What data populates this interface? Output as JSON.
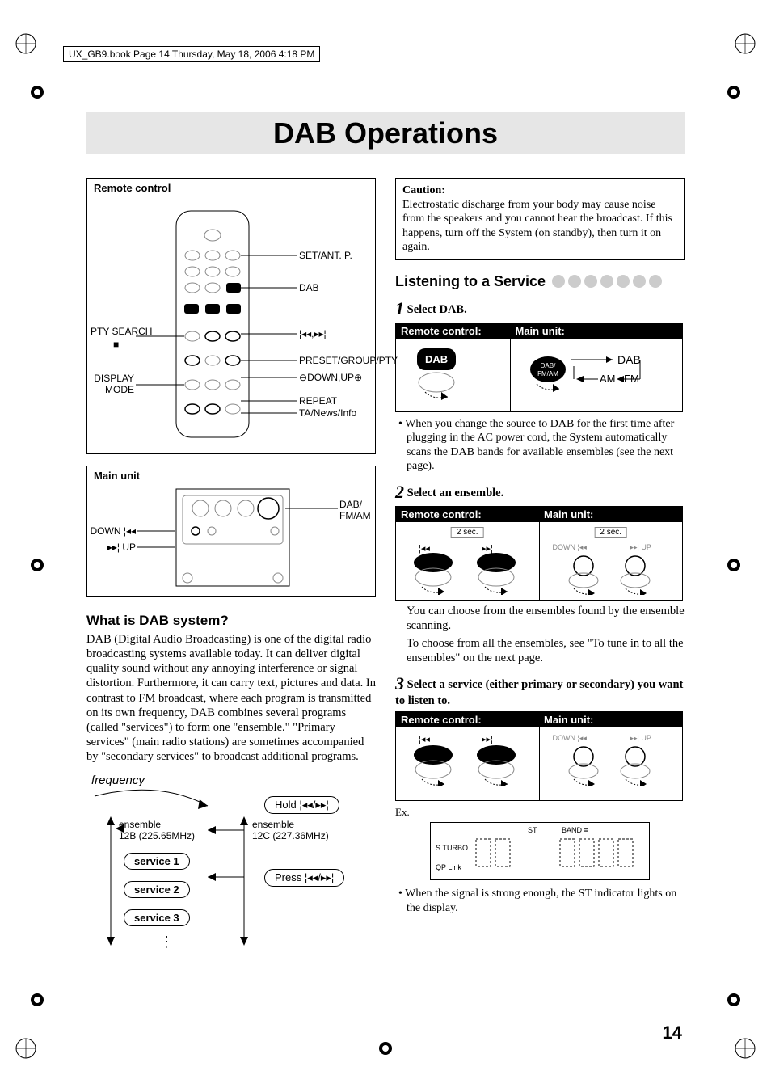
{
  "book_info": "UX_GB9.book  Page 14  Thursday, May 18, 2006  4:18 PM",
  "page_title": "DAB Operations",
  "page_number": "14",
  "remote_box": {
    "title": "Remote control",
    "labels": {
      "set_ant": "SET/ANT. P.",
      "dab": "DAB",
      "prev_next": "¦◂◂,▸▸¦",
      "preset_group_pty": "PRESET/GROUP/PTY",
      "down_up": "DOWN,UP",
      "repeat": "REPEAT",
      "ta_news": "TA/News/Info",
      "pty_search": "PTY SEARCH",
      "stop": "■",
      "display_mode": "DISPLAY\nMODE"
    }
  },
  "mainunit_box": {
    "title": "Main unit",
    "labels": {
      "dab_fmam": "DAB/\nFM/AM",
      "down": "DOWN ¦◂◂",
      "up": "▸▸¦ UP"
    }
  },
  "what_is_dab": {
    "heading": "What is DAB system?",
    "body": "DAB (Digital Audio Broadcasting) is one of the digital radio broadcasting systems available today. It can deliver digital quality sound without any annoying interference or signal distortion. Furthermore, it can carry text, pictures and data. In contrast to FM broadcast, where each program is transmitted on its own frequency, DAB combines several programs (called \"services\") to form one \"ensemble.\" \"Primary services\" (main radio stations) are sometimes accompanied by \"secondary services\" to broadcast additional programs."
  },
  "freq_diagram": {
    "frequency": "frequency",
    "hold": "Hold ¦◂◂/▸▸¦",
    "press": "Press ¦◂◂/▸▸¦",
    "ensemble_a": "ensemble\n12B (225.65MHz)",
    "ensemble_b": "ensemble\n12C (227.36MHz)",
    "service1": "service 1",
    "service2": "service 2",
    "service3": "service 3"
  },
  "caution": {
    "title": "Caution:",
    "body": "Electrostatic discharge from your body may cause noise from the speakers and you cannot hear the broadcast. If this happens, turn off the System (on standby), then turn it on again."
  },
  "section_heading": "Listening to a Service",
  "step1": {
    "num": "1",
    "text": "Select DAB.",
    "remote_hdr": "Remote control:",
    "main_hdr": "Main unit:",
    "dab_btn": "DAB",
    "main_label": "DAB/\nFM/AM",
    "flow": {
      "dab": "DAB",
      "am": "AM",
      "fm": "FM"
    },
    "note": "• When you change the source to DAB for the first time after plugging in the AC power cord, the System automatically scans the DAB bands for available ensembles (see the next page)."
  },
  "step2": {
    "num": "2",
    "text": "Select an ensemble.",
    "remote_hdr": "Remote control:",
    "main_hdr": "Main unit:",
    "two_sec": "2 sec.",
    "down": "DOWN ¦◂◂",
    "up": "▸▸¦ UP",
    "note1": "You can choose from the ensembles found by the ensemble scanning.",
    "note2": "To choose from all the ensembles, see \"To tune in to all the ensembles\" on the next page."
  },
  "step3": {
    "num": "3",
    "text": "Select a service (either primary or secondary) you want to listen to.",
    "remote_hdr": "Remote control:",
    "main_hdr": "Main unit:",
    "down": "DOWN ¦◂◂",
    "up": "▸▸¦ UP"
  },
  "example": {
    "ex": "Ex.",
    "st": "ST",
    "band": "BAND",
    "sturbo": "S.TURBO",
    "qplink": "QP Link",
    "note": "• When the signal is strong enough, the ST indicator lights on the display."
  }
}
